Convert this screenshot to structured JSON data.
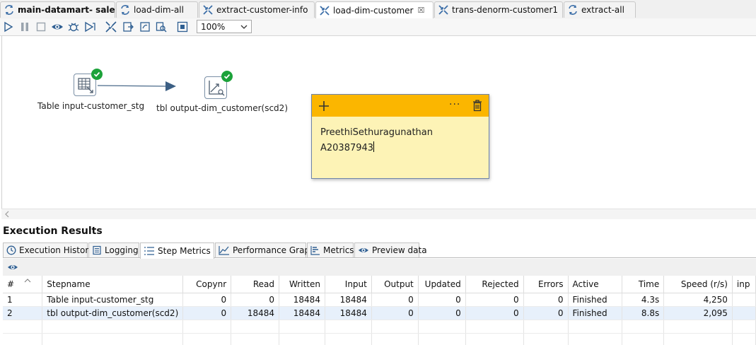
{
  "tabs": [
    {
      "label": "main-datamart- sales",
      "icon": "job-icon",
      "bold": true,
      "active": false
    },
    {
      "label": "load-dim-all",
      "icon": "job-icon",
      "bold": false,
      "active": false
    },
    {
      "label": "extract-customer-info",
      "icon": "transformation-icon",
      "bold": false,
      "active": false
    },
    {
      "label": "load-dim-customer",
      "icon": "transformation-icon",
      "bold": false,
      "active": true,
      "close": "☒"
    },
    {
      "label": "trans-denorm-customer1",
      "icon": "transformation-icon",
      "bold": false,
      "active": false
    },
    {
      "label": "extract-all",
      "icon": "job-icon",
      "bold": false,
      "active": false
    }
  ],
  "toolbar": {
    "zoom_value": "100%"
  },
  "canvas": {
    "steps": [
      {
        "label": "Table input-customer_stg",
        "icon": "table-input-icon",
        "status": "success"
      },
      {
        "label": "tbl output-dim_customer(scd2)",
        "icon": "dimension-lookup-icon",
        "status": "success"
      }
    ],
    "note": {
      "line1": "PreethiSethuragunathan",
      "line2": "A20387943",
      "more_label": "···"
    }
  },
  "execution": {
    "title": "Execution Results",
    "tabs": [
      {
        "label": "Execution History",
        "icon": "history-icon"
      },
      {
        "label": "Logging",
        "icon": "log-icon"
      },
      {
        "label": "Step Metrics",
        "icon": "list-icon",
        "active": true
      },
      {
        "label": "Performance Graph",
        "icon": "graph-icon"
      },
      {
        "label": "Metrics",
        "icon": "metrics-icon"
      },
      {
        "label": "Preview data",
        "icon": "eye-icon"
      }
    ],
    "table": {
      "headers": [
        "#",
        "Stepname",
        "Copynr",
        "Read",
        "Written",
        "Input",
        "Output",
        "Updated",
        "Rejected",
        "Errors",
        "Active",
        "Time",
        "Speed (r/s)",
        "inp"
      ],
      "rows": [
        [
          "1",
          "Table input-customer_stg",
          "0",
          "0",
          "18484",
          "18484",
          "0",
          "0",
          "0",
          "0",
          "Finished",
          "4.3s",
          "4,250",
          ""
        ],
        [
          "2",
          "tbl output-dim_customer(scd2)",
          "0",
          "18484",
          "18484",
          "18484",
          "0",
          "0",
          "0",
          "0",
          "Finished",
          "8.8s",
          "2,095",
          ""
        ]
      ]
    }
  },
  "colors": {
    "note_header": "#fbb600",
    "note_body": "#fdf3b6",
    "success": "#1ca23a",
    "hop": "#4a6a8a"
  }
}
